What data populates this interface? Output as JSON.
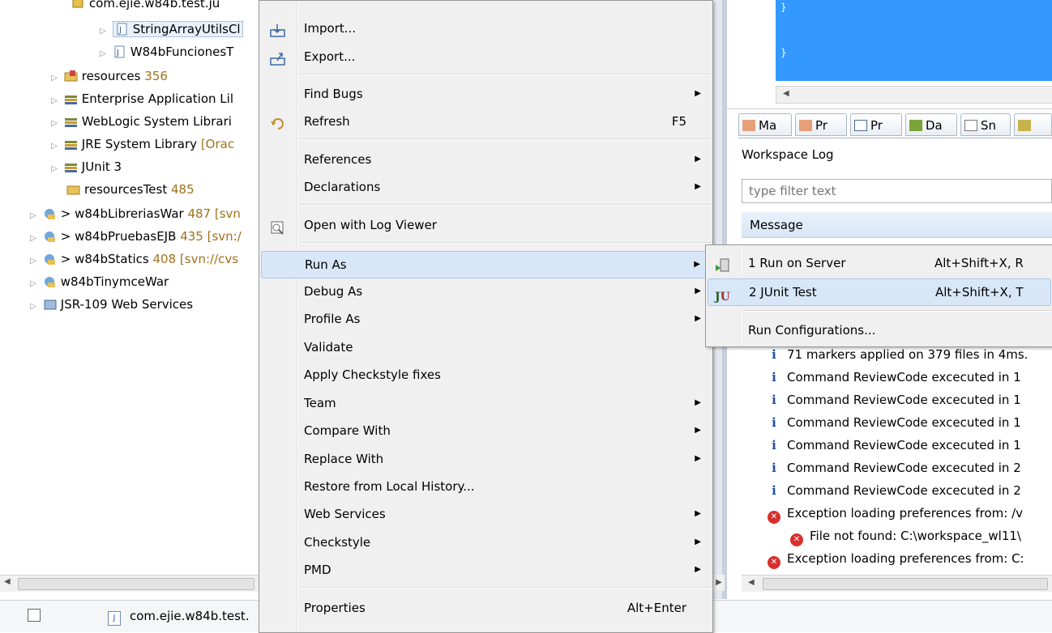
{
  "tree": {
    "items": [
      {
        "label": "com.ejie.w84b.test.ju",
        "count": "",
        "extra": ""
      },
      {
        "label": "StringArrayUtilsCl",
        "count": "",
        "extra": ""
      },
      {
        "label": "W84bFuncionesT",
        "count": "",
        "extra": ""
      },
      {
        "label": "resources",
        "count": "356",
        "extra": ""
      },
      {
        "label": "Enterprise Application Lil",
        "count": "",
        "extra": ""
      },
      {
        "label": "WebLogic System Librari",
        "count": "",
        "extra": ""
      },
      {
        "label": "JRE System Library",
        "count": "",
        "extra": "[Orac"
      },
      {
        "label": "JUnit 3",
        "count": "",
        "extra": ""
      },
      {
        "label": "resourcesTest",
        "count": "485",
        "extra": ""
      },
      {
        "label": "> w84bLibreriasWar",
        "count": "487",
        "extra": "[svn"
      },
      {
        "label": "> w84bPruebasEJB",
        "count": "435",
        "extra": "[svn:/"
      },
      {
        "label": "> w84bStatics",
        "count": "408",
        "extra": "[svn://cvs"
      },
      {
        "label": "w84bTinymceWar",
        "count": "",
        "extra": ""
      },
      {
        "label": "JSR-109 Web Services",
        "count": "",
        "extra": ""
      }
    ]
  },
  "status_bar": {
    "file": "com.ejie.w84b.test."
  },
  "context_menu": {
    "import": "Import...",
    "export": "Export...",
    "find_bugs": "Find Bugs",
    "refresh": "Refresh",
    "refresh_accel": "F5",
    "references": "References",
    "declarations": "Declarations",
    "open_log_viewer": "Open with Log Viewer",
    "run_as": "Run As",
    "debug_as": "Debug As",
    "profile_as": "Profile As",
    "validate": "Validate",
    "apply_checkstyle": "Apply Checkstyle fixes",
    "team": "Team",
    "compare_with": "Compare With",
    "replace_with": "Replace With",
    "restore_history": "Restore from Local History...",
    "web_services": "Web Services",
    "checkstyle": "Checkstyle",
    "pmd": "PMD",
    "properties": "Properties",
    "properties_accel": "Alt+Enter"
  },
  "submenu": {
    "run_on_server": "1 Run on Server",
    "run_on_server_accel": "Alt+Shift+X, R",
    "junit_test": "2 JUnit Test",
    "junit_test_accel": "Alt+Shift+X, T",
    "run_configurations": "Run Configurations..."
  },
  "right_panel": {
    "tabs": [
      "Ma",
      "Pr",
      "Pr",
      "Da",
      "Sn"
    ],
    "view_title": "Workspace Log",
    "filter_placeholder": "type filter text",
    "column_header": "Message",
    "log_rows": [
      {
        "type": "info",
        "text": "71 markers applied on 379 files in 4ms."
      },
      {
        "type": "info",
        "text": "Command ReviewCode excecuted in 1"
      },
      {
        "type": "info",
        "text": "Command ReviewCode excecuted in 1"
      },
      {
        "type": "info",
        "text": "Command ReviewCode excecuted in 1"
      },
      {
        "type": "info",
        "text": "Command ReviewCode excecuted in 1"
      },
      {
        "type": "info",
        "text": "Command ReviewCode excecuted in 2"
      },
      {
        "type": "info",
        "text": "Command ReviewCode excecuted in 2"
      },
      {
        "type": "error",
        "text": "Exception loading preferences from: /v"
      },
      {
        "type": "error-child",
        "text": "File not found: C:\\workspace_wl11\\"
      },
      {
        "type": "error",
        "text": "Exception loading preferences from: C:"
      }
    ]
  },
  "colors": {
    "menu_bg": "#f0f0f0",
    "highlight": "#d8e7f8",
    "editor_blue": "#3399ff",
    "count": "#a0711c"
  }
}
